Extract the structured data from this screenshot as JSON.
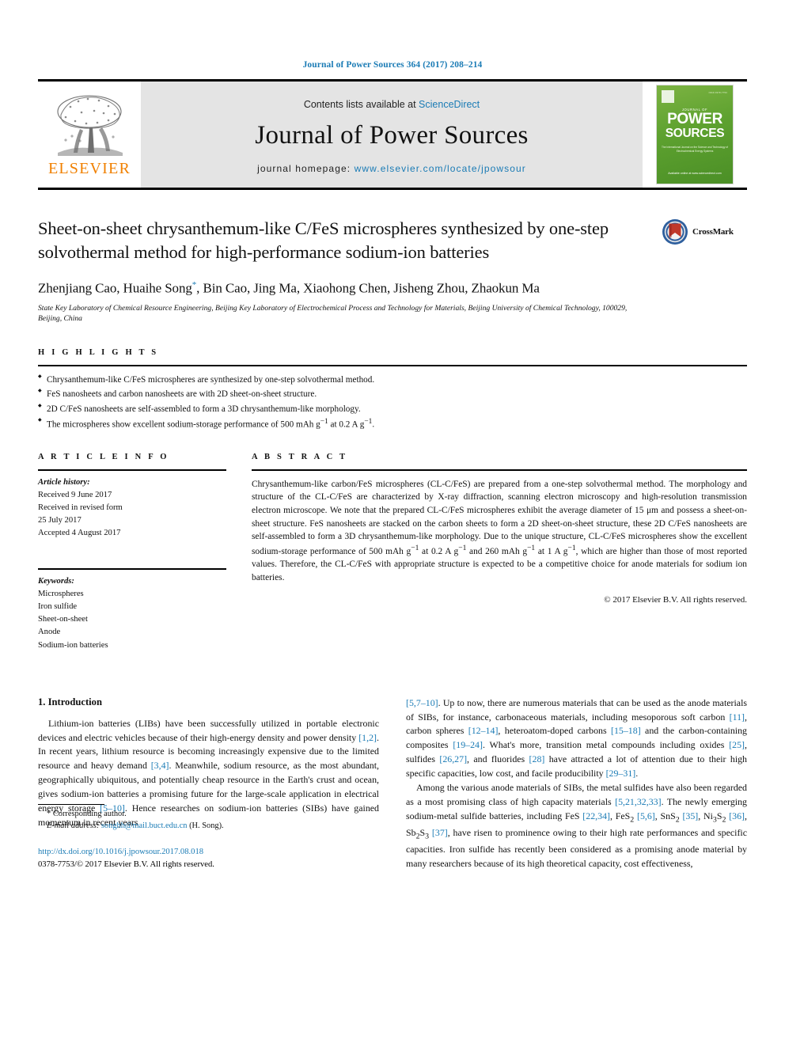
{
  "running_head": "Journal of Power Sources 364 (2017) 208–214",
  "colors": {
    "link": "#1a7bb5",
    "elsevier_orange": "#f08000",
    "cover_green": "#5da12f"
  },
  "masthead": {
    "publisher_name": "ELSEVIER",
    "contents_prefix": "Contents lists available at ",
    "contents_link": "ScienceDirect",
    "journal_name": "Journal of Power Sources",
    "homepage_prefix": "journal homepage: ",
    "homepage_url": "www.elsevier.com/locate/jpowsour",
    "cover": {
      "eyebrow": "JOURNAL OF",
      "title_line1": "POWER",
      "title_line2": "SOURCES",
      "subtitle": "The International Journal on the Science and Technology of Electrochemical Energy Systems",
      "bottom": "Available online at\nwww.sciencedirect.com",
      "corner": "ISSN 0378-7753"
    }
  },
  "article": {
    "title": "Sheet-on-sheet chrysanthemum-like C/FeS microspheres synthesized by one-step solvothermal method for high-performance sodium-ion batteries",
    "crossmark_label": "CrossMark",
    "authors": "Zhenjiang Cao, Huaihe Song",
    "authors_rest": ", Bin Cao, Jing Ma, Xiaohong Chen, Jisheng Zhou, Zhaokun Ma",
    "corresponding_marker": "*",
    "affiliation": "State Key Laboratory of Chemical Resource Engineering, Beijing Key Laboratory of Electrochemical Process and Technology for Materials, Beijing University of Chemical Technology, 100029, Beijing, China"
  },
  "highlights": {
    "label": "H I G H L I G H T S",
    "items": [
      "Chrysanthemum-like C/FeS microspheres are synthesized by one-step solvothermal method.",
      "FeS nanosheets and carbon nanosheets are with 2D sheet-on-sheet structure.",
      "2D C/FeS nanosheets are self-assembled to form a 3D chrysanthemum-like morphology.",
      "The microspheres show excellent sodium-storage performance of 500 mAh g−1 at 0.2 A g−1."
    ]
  },
  "article_info": {
    "label": "A R T I C L E   I N F O",
    "history_title": "Article history:",
    "history_lines": [
      "Received 9 June 2017",
      "Received in revised form",
      "25 July 2017",
      "Accepted 4 August 2017"
    ],
    "keywords_title": "Keywords:",
    "keywords": [
      "Microspheres",
      "Iron sulfide",
      "Sheet-on-sheet",
      "Anode",
      "Sodium-ion batteries"
    ]
  },
  "abstract": {
    "label": "A B S T R A C T",
    "text": "Chrysanthemum-like carbon/FeS microspheres (CL-C/FeS) are prepared from a one-step solvothermal method. The morphology and structure of the CL-C/FeS are characterized by X-ray diffraction, scanning electron microscopy and high-resolution transmission electron microscope. We note that the prepared CL-C/FeS microspheres exhibit the average diameter of 15 μm and possess a sheet-on-sheet structure. FeS nanosheets are stacked on the carbon sheets to form a 2D sheet-on-sheet structure, these 2D C/FeS nanosheets are self-assembled to form a 3D chrysanthemum-like morphology. Due to the unique structure, CL-C/FeS microspheres show the excellent sodium-storage performance of 500 mAh g−1 at 0.2 A g−1 and 260 mAh g−1 at 1 A g−1, which are higher than those of most reported values. Therefore, the CL-C/FeS with appropriate structure is expected to be a competitive choice for anode materials for sodium ion batteries.",
    "copyright": "© 2017 Elsevier B.V. All rights reserved."
  },
  "introduction": {
    "heading": "1. Introduction",
    "left_paragraph": "Lithium-ion batteries (LIBs) have been successfully utilized in portable electronic devices and electric vehicles because of their high-energy density and power density [1,2]. In recent years, lithium resource is becoming increasingly expensive due to the limited resource and heavy demand [3,4]. Meanwhile, sodium resource, as the most abundant, geographically ubiquitous, and potentially cheap resource in the Earth's crust and ocean, gives sodium-ion batteries a promising future for the large-scale application in electrical energy storage [5–10]. Hence researches on sodium-ion batteries (SIBs) have gained momentum in recent years",
    "right_paragraph_1": "[5,7–10]. Up to now, there are numerous materials that can be used as the anode materials of SIBs, for instance, carbonaceous materials, including mesoporous soft carbon [11], carbon spheres [12–14], heteroatom-doped carbons [15–18] and the carbon-containing composites [19–24]. What's more, transition metal compounds including oxides [25], sulfides [26,27], and fluorides [28] have attracted a lot of attention due to their high specific capacities, low cost, and facile producibility [29–31].",
    "right_paragraph_2": "Among the various anode materials of SIBs, the metal sulfides have also been regarded as a most promising class of high capacity materials [5,21,32,33]. The newly emerging sodium-metal sulfide batteries, including FeS [22,34], FeS2 [5,6], SnS2 [35], Ni3S2 [36], Sb2S3 [37], have risen to prominence owing to their high rate performances and specific capacities. Iron sulfide has recently been considered as a promising anode material by many researchers because of its high theoretical capacity, cost effectiveness,"
  },
  "footer": {
    "corresponding_marker": "*",
    "corresponding_label": "Corresponding author.",
    "email_label": "E-mail address:",
    "email": "songhh@mail.buct.edu.cn",
    "email_suffix": "(H. Song).",
    "doi": "http://dx.doi.org/10.1016/j.jpowsour.2017.08.018",
    "issn_line": "0378-7753/© 2017 Elsevier B.V. All rights reserved."
  }
}
